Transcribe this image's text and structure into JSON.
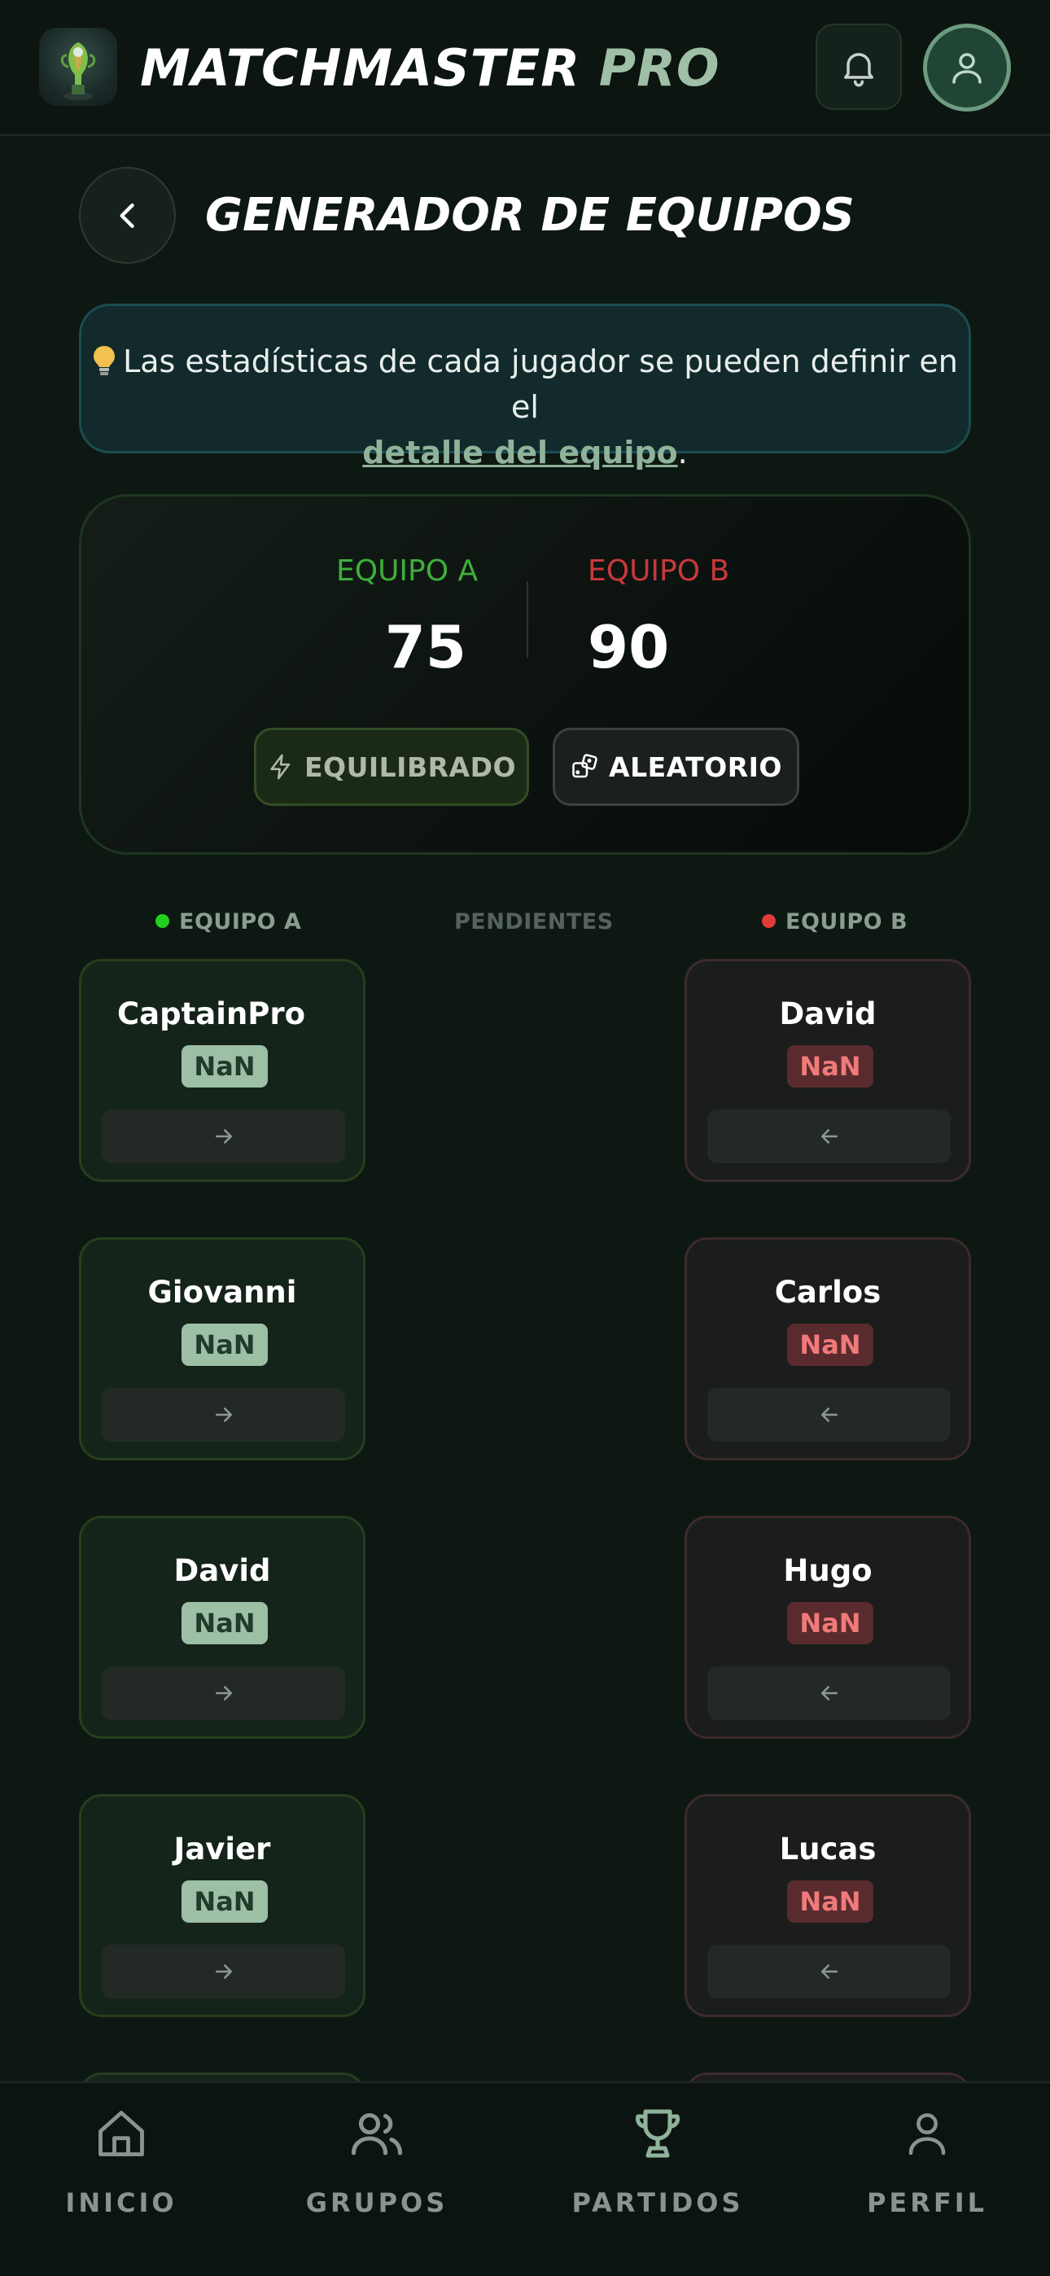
{
  "header": {
    "brand_main": "MATCHMASTER",
    "brand_accent": "PRO",
    "icons": {
      "logo": "trophy-logo",
      "notifications": "bell-icon",
      "profile": "user-icon"
    }
  },
  "title_bar": {
    "back_icon": "chevron-left-icon",
    "title": "GENERADOR DE EQUIPOS"
  },
  "info_banner": {
    "icon": "lightbulb-icon",
    "text": "Las estadísticas de cada jugador se pueden definir en el",
    "link": "detalle del equipo",
    "suffix": "."
  },
  "score": {
    "team_a_label": "EQUIPO A",
    "team_b_label": "EQUIPO B",
    "team_a_score": "75",
    "team_b_score": "90",
    "balanced_label": "EQUILIBRADO",
    "random_label": "ALEATORIO"
  },
  "columns": {
    "team_a": "EQUIPO A",
    "pending": "PENDIENTES",
    "team_b": "EQUIPO B"
  },
  "team_a_players": [
    {
      "name": "CaptainPro",
      "rating": "NaN"
    },
    {
      "name": "Giovanni",
      "rating": "NaN"
    },
    {
      "name": "David",
      "rating": "NaN"
    },
    {
      "name": "Javier",
      "rating": "NaN"
    }
  ],
  "team_b_players": [
    {
      "name": "David",
      "rating": "NaN"
    },
    {
      "name": "Carlos",
      "rating": "NaN"
    },
    {
      "name": "Hugo",
      "rating": "NaN"
    },
    {
      "name": "Lucas",
      "rating": "NaN"
    }
  ],
  "colors": {
    "team_a": "#22d11f",
    "team_b": "#e13b3b",
    "accent": "#9fbfa6"
  },
  "bottom_nav": [
    {
      "label": "INICIO",
      "icon": "home-icon"
    },
    {
      "label": "GRUPOS",
      "icon": "users-icon"
    },
    {
      "label": "PARTIDOS",
      "icon": "trophy-icon"
    },
    {
      "label": "PERFIL",
      "icon": "user-icon"
    }
  ]
}
